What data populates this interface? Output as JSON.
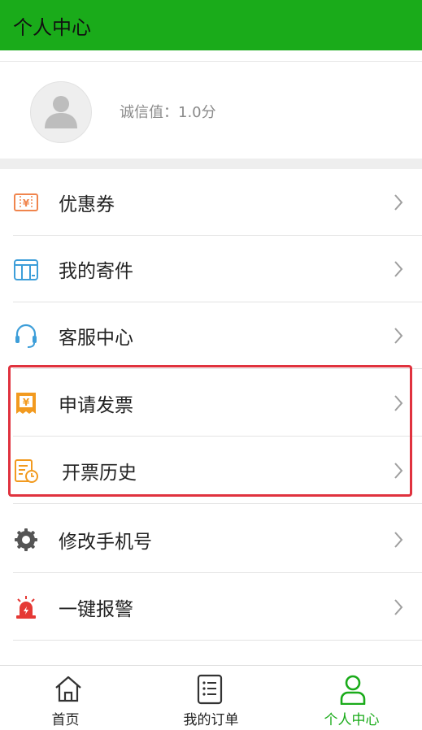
{
  "header": {
    "title": "个人中心"
  },
  "profile": {
    "score_text": "诚信值：1.0分"
  },
  "menu": {
    "items": [
      {
        "label": "优惠券",
        "icon": "coupon-icon"
      },
      {
        "label": "我的寄件",
        "icon": "package-icon"
      },
      {
        "label": "客服中心",
        "icon": "headset-icon"
      },
      {
        "label": "申请发票",
        "icon": "invoice-icon"
      },
      {
        "label": "开票历史",
        "icon": "invoice-history-icon"
      },
      {
        "label": "修改手机号",
        "icon": "gear-icon"
      },
      {
        "label": "一键报警",
        "icon": "alarm-icon"
      }
    ]
  },
  "tabbar": {
    "tabs": [
      {
        "label": "首页",
        "icon": "home-icon",
        "active": false
      },
      {
        "label": "我的订单",
        "icon": "order-list-icon",
        "active": false
      },
      {
        "label": "个人中心",
        "icon": "person-icon",
        "active": true
      }
    ]
  },
  "colors": {
    "brand_green": "#1aab1a",
    "highlight_red": "#e0323e",
    "coupon_orange": "#f0854d",
    "icon_blue": "#3d9ed9",
    "invoice_orange": "#f29a1f",
    "alarm_red": "#e53935"
  }
}
